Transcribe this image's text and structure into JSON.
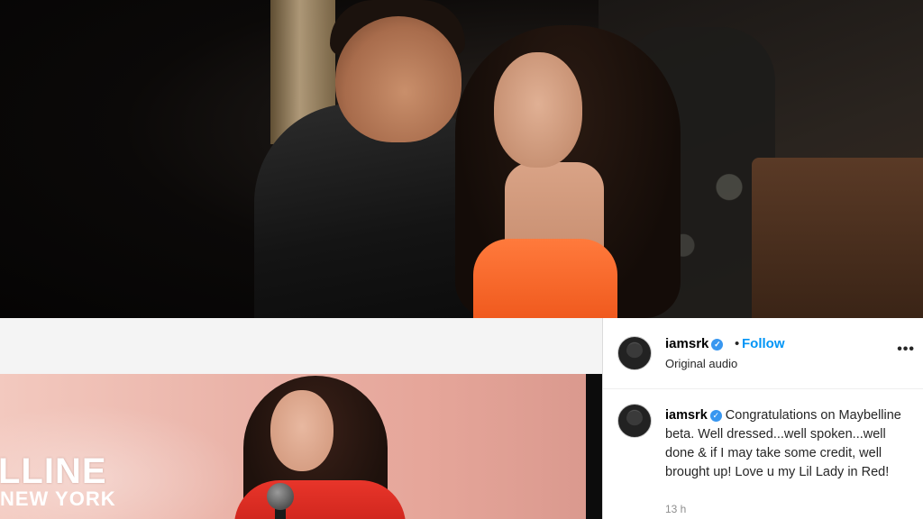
{
  "post": {
    "username": "iamsrk",
    "separator": "•",
    "follow_label": "Follow",
    "audio_label": "Original audio",
    "more_label": "•••",
    "verified_glyph": "✓"
  },
  "caption": {
    "username": "iamsrk",
    "text": "Congratulations on Maybelline beta. Well dressed...well spoken...well done & if I may take some credit, well brought up! Love u my Lil Lady in Red!",
    "timestamp": "13 h"
  },
  "video": {
    "brand_line1": "LLINE",
    "brand_line2": "NEW YORK"
  },
  "colors": {
    "follow": "#0095f6",
    "verified": "#3897f0",
    "dress": "#f05a1e",
    "jacket": "#e8352a"
  }
}
